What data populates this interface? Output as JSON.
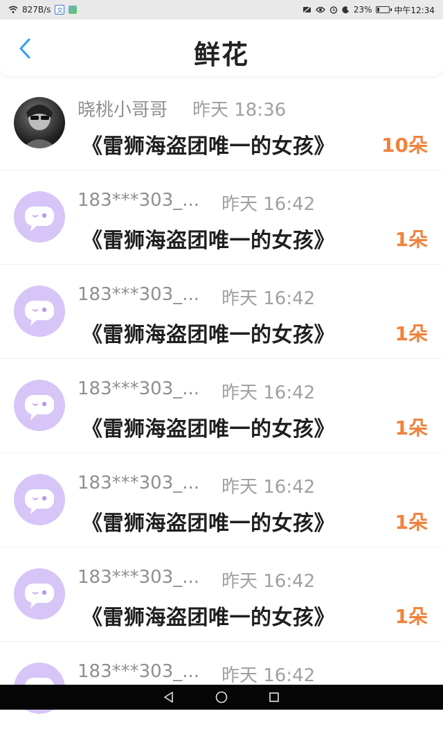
{
  "status_bar": {
    "speed": "827B/s",
    "battery": "23%",
    "battery_level": 0.23,
    "clock": "中午12:34",
    "icons": [
      "wifi-icon",
      "translate-app-icon",
      "app-badge-icon",
      "notification-off-icon",
      "eye-icon",
      "alarm-icon",
      "do-not-disturb-icon",
      "battery-icon"
    ]
  },
  "header": {
    "title": "鲜花",
    "back_icon": "chevron-left-icon",
    "accent": "#2f9bff"
  },
  "list": {
    "items": [
      {
        "name": "晓桃小哥哥",
        "time": "昨天 18:36",
        "book": "《雷狮海盗团唯一的女孩》",
        "count": "10朵",
        "avatar": "photo"
      },
      {
        "name": "183***303_...",
        "time": "昨天 16:42",
        "book": "《雷狮海盗团唯一的女孩》",
        "count": "1朵",
        "avatar": "default"
      },
      {
        "name": "183***303_...",
        "time": "昨天 16:42",
        "book": "《雷狮海盗团唯一的女孩》",
        "count": "1朵",
        "avatar": "default"
      },
      {
        "name": "183***303_...",
        "time": "昨天 16:42",
        "book": "《雷狮海盗团唯一的女孩》",
        "count": "1朵",
        "avatar": "default"
      },
      {
        "name": "183***303_...",
        "time": "昨天 16:42",
        "book": "《雷狮海盗团唯一的女孩》",
        "count": "1朵",
        "avatar": "default"
      },
      {
        "name": "183***303_...",
        "time": "昨天 16:42",
        "book": "《雷狮海盗团唯一的女孩》",
        "count": "1朵",
        "avatar": "default"
      },
      {
        "name": "183***303_...",
        "time": "昨天 16:42",
        "book": "",
        "count": "",
        "avatar": "default"
      }
    ]
  },
  "colors": {
    "count_orange": "#f0823c",
    "avatar_default_bg": "#d7c5f7"
  },
  "nav": {
    "icons": [
      "back-triangle-icon",
      "home-circle-icon",
      "recent-square-icon"
    ]
  }
}
